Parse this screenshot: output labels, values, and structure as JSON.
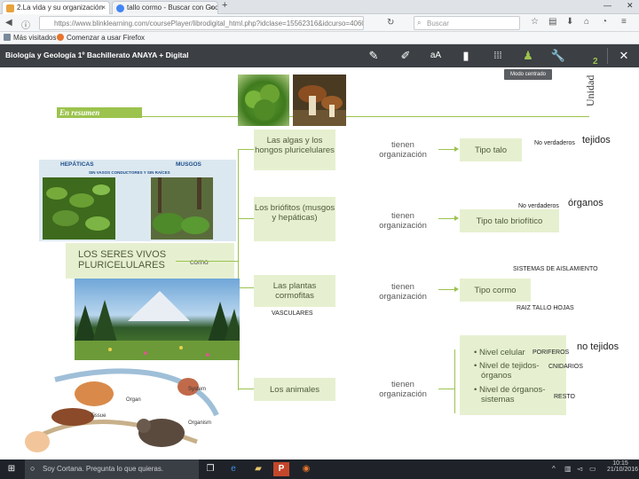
{
  "browser": {
    "tabs": [
      {
        "label": "2.La vida y su organización",
        "active": true
      },
      {
        "label": "tallo cormo - Buscar con Google",
        "active": false
      }
    ],
    "new_tab": "+",
    "url": "https://www.blinklearning.com/coursePlayer/librodigital_html.php?idclase=15562316&idcurso=406009#",
    "search_placeholder": "Buscar",
    "bookmarks": [
      {
        "label": "Más visitados"
      },
      {
        "label": "Comenzar a usar Firefox"
      }
    ]
  },
  "app": {
    "title": "Biología y Geología 1º Bachillerato ANAYA + Digital",
    "tools": [
      "pencil-icon",
      "marker-icon",
      "text-size-icon",
      "book-icon",
      "apps-grid-icon",
      "person-center-icon",
      "wrench-icon",
      "close-icon"
    ],
    "tooltip": "Modo centrado",
    "font_toggle": "aA"
  },
  "page": {
    "unidad": "Unidad",
    "unidad_num": "2",
    "resumen_title": "En resumen",
    "main_label": "LOS SERES VIVOS PLURICELULARES",
    "como": "como",
    "hepaticas": "HEPÁTICAS",
    "musgos": "MUSGOS",
    "sin_vasos": "SIN VASOS CONDUCTORES Y SIN RAÍCES",
    "vasculares": "VASCULARES",
    "rows": [
      {
        "group": "Las algas y los hongos pluricelulares",
        "verb": "tienen organización",
        "result": "Tipo talo"
      },
      {
        "group": "Los briófitos (musgos y hepáticas)",
        "verb": "tienen organización",
        "result": "Tipo talo briofítico"
      },
      {
        "group": "Las plantas cormofitas",
        "verb": "tienen organización",
        "result": "Tipo cormo"
      },
      {
        "group": "Los animales",
        "verb": "tienen organización",
        "result": ""
      }
    ],
    "animal_levels": [
      "• Nivel celular",
      "• Nivel de tejidos-",
      "órganos",
      "• Nivel de órganos-",
      "sistemas"
    ],
    "notes": {
      "no_verdaderos_1": "No verdaderos",
      "tejidos": "tejidos",
      "no_verdaderos_2": "No verdaderos",
      "organos": "órganos",
      "sistemas_aislamiento": "SISTEMAS DE AISLAMIENTO",
      "raiz_tallo_hojas": "RAIZ TALLO HOJAS",
      "poriferos": "PORIFEROS",
      "no_tejidos": "no tejidos",
      "cnidarios": "CNIDARIOS",
      "resto": "RESTO"
    },
    "diagram_labels": [
      "System",
      "Organ",
      "Tissue",
      "Organism"
    ]
  },
  "taskbar": {
    "cortana": "Soy Cortana. Pregunta lo que quieras.",
    "time": "10:15",
    "date": "21/10/2016"
  },
  "colors": {
    "accent_green": "#9cc34e",
    "box_green": "#e6f0d0",
    "header_dark": "#3c3f43"
  }
}
